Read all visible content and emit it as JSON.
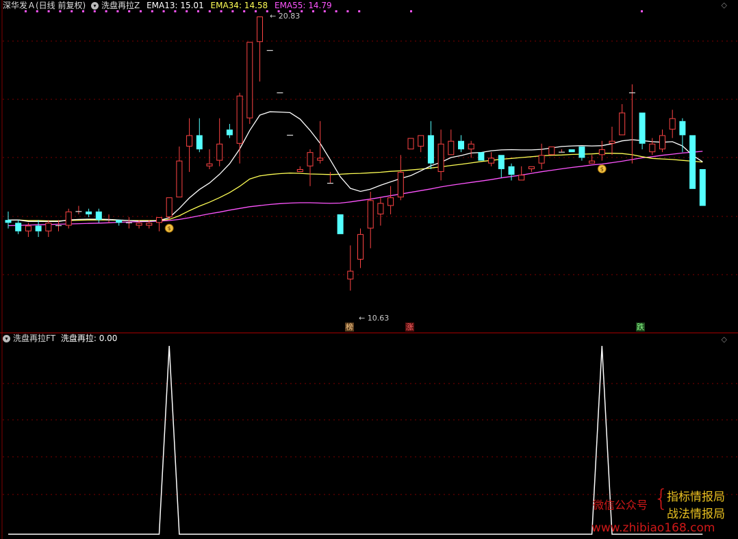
{
  "main_header": {
    "stock": "深华发Ａ(日线 前复权)",
    "indicator": "洗盘再拉Z",
    "ema13_label": "EMA13: 15.01",
    "ema34_label": "EMA34: 14.58",
    "ema55_label": "EMA55: 14.79"
  },
  "sub_header": {
    "indicator": "洗盘再拉FT",
    "value_label": "洗盘再拉: 0.00"
  },
  "price_labels": {
    "high": "20.83",
    "low": "10.63"
  },
  "event_tags": {
    "bang": "榜",
    "zhang": "涨",
    "die": "跌"
  },
  "window_icon": "◇",
  "watermark": {
    "wechat": "微信公众号",
    "line1": "指标情报局",
    "line2": "战法情报局",
    "url": "www.zhibiao168.com"
  },
  "colors": {
    "up": "#ff4444",
    "down": "#54ffff",
    "ema13": "#ffffff",
    "ema34": "#ffff55",
    "ema55": "#ff55ff",
    "grid": "#800000"
  },
  "chart_data": [
    {
      "type": "candlestick",
      "title": "洗盘再拉Z",
      "price_min_shown": 10.63,
      "price_max_shown": 20.83,
      "candles": [
        [
          13.6,
          13.5,
          13.9,
          13.3
        ],
        [
          13.5,
          13.2,
          13.6,
          13.1
        ],
        [
          13.2,
          13.4,
          13.5,
          13.0
        ],
        [
          13.4,
          13.2,
          13.6,
          13.0
        ],
        [
          13.2,
          13.5,
          13.6,
          13.0
        ],
        [
          13.4,
          13.4,
          13.6,
          13.2
        ],
        [
          13.4,
          13.9,
          14.0,
          13.3
        ],
        [
          13.9,
          13.9,
          14.1,
          13.8
        ],
        [
          13.9,
          13.8,
          14.0,
          13.7
        ],
        [
          13.9,
          13.6,
          14.0,
          13.5
        ],
        [
          13.6,
          13.6,
          13.8,
          13.5
        ],
        [
          13.6,
          13.5,
          13.6,
          13.4
        ],
        [
          13.5,
          13.5,
          13.7,
          13.3
        ],
        [
          13.4,
          13.5,
          13.6,
          13.3
        ],
        [
          13.4,
          13.5,
          13.6,
          13.3
        ],
        [
          13.5,
          13.7,
          13.7,
          13.2
        ],
        [
          13.7,
          14.4,
          14.4,
          13.6
        ],
        [
          14.4,
          15.7,
          16.2,
          14.4
        ],
        [
          16.2,
          16.6,
          17.2,
          15.3
        ],
        [
          16.6,
          16.1,
          17.2,
          16.0
        ],
        [
          15.5,
          15.6,
          16.1,
          15.4
        ],
        [
          15.7,
          16.3,
          17.2,
          15.5
        ],
        [
          16.8,
          16.6,
          17.0,
          16.5
        ],
        [
          16.3,
          18.0,
          18.1,
          15.6
        ],
        [
          17.2,
          19.9,
          19.9,
          17.0
        ],
        [
          19.9,
          20.8,
          20.8,
          18.5
        ],
        [
          19.6,
          19.6,
          19.6,
          19.6
        ],
        [
          18.1,
          18.1,
          18.1,
          18.1
        ],
        [
          16.6,
          16.6,
          16.6,
          16.6
        ],
        [
          15.3,
          15.4,
          15.5,
          15.3
        ],
        [
          15.5,
          16.0,
          16.1,
          14.8
        ],
        [
          15.7,
          15.8,
          17.1,
          15.6
        ],
        [
          14.9,
          14.9,
          15.3,
          14.9
        ],
        [
          13.8,
          13.1,
          13.8,
          13.1
        ],
        [
          11.5,
          11.8,
          12.7,
          11.1
        ],
        [
          12.2,
          13.1,
          13.3,
          11.9
        ],
        [
          13.3,
          14.3,
          14.6,
          12.6
        ],
        [
          13.8,
          14.2,
          14.4,
          13.4
        ],
        [
          14.1,
          14.4,
          14.8,
          13.8
        ],
        [
          14.4,
          15.3,
          15.9,
          14.3
        ],
        [
          16.1,
          16.5,
          16.5,
          16.3
        ],
        [
          16.2,
          16.6,
          16.6,
          16.0
        ],
        [
          16.6,
          15.6,
          17.1,
          15.4
        ],
        [
          15.3,
          16.3,
          16.8,
          15.0
        ],
        [
          15.9,
          16.4,
          16.8,
          15.9
        ],
        [
          16.4,
          16.1,
          16.6,
          16.0
        ],
        [
          16.1,
          16.3,
          16.4,
          15.8
        ],
        [
          16.0,
          15.7,
          16.0,
          15.7
        ],
        [
          15.6,
          15.8,
          16.0,
          15.5
        ],
        [
          15.9,
          15.4,
          15.9,
          15.1
        ],
        [
          15.5,
          15.2,
          15.6,
          15.0
        ],
        [
          15.0,
          15.2,
          15.5,
          15.0
        ],
        [
          15.4,
          15.5,
          15.5,
          15.3
        ],
        [
          15.6,
          15.9,
          16.3,
          15.4
        ],
        [
          15.9,
          16.2,
          16.2,
          16.0
        ],
        [
          16.0,
          16.0,
          16.1,
          16.0
        ],
        [
          16.1,
          16.0,
          16.1,
          16.0
        ],
        [
          16.2,
          15.8,
          16.2,
          15.7
        ],
        [
          15.6,
          15.7,
          15.9,
          15.6
        ],
        [
          15.9,
          16.1,
          16.4,
          15.7
        ],
        [
          16.3,
          16.4,
          16.9,
          15.9
        ],
        [
          16.6,
          17.4,
          17.7,
          16.6
        ],
        [
          18.1,
          18.1,
          18.4,
          15.6
        ],
        [
          17.4,
          16.3,
          17.4,
          16.1
        ],
        [
          16.0,
          16.3,
          16.5,
          15.9
        ],
        [
          16.1,
          16.6,
          16.8,
          16.0
        ],
        [
          16.8,
          17.2,
          17.5,
          16.5
        ],
        [
          17.1,
          16.6,
          17.2,
          16.0
        ],
        [
          16.6,
          14.7,
          16.6,
          14.7
        ],
        [
          15.4,
          14.1,
          15.4,
          14.1
        ]
      ],
      "ema13": [
        13.6,
        13.6,
        13.55,
        13.55,
        13.55,
        13.55,
        13.6,
        13.62,
        13.63,
        13.63,
        13.62,
        13.6,
        13.58,
        13.56,
        13.56,
        13.58,
        13.68,
        14.01,
        14.38,
        14.68,
        14.91,
        15.22,
        15.59,
        16.11,
        16.77,
        17.31,
        17.43,
        17.42,
        17.4,
        17.17,
        16.77,
        16.31,
        15.73,
        15.13,
        14.72,
        14.61,
        14.69,
        14.83,
        14.95,
        15.07,
        15.17,
        15.34,
        15.52,
        15.64,
        15.81,
        15.88,
        15.97,
        15.99,
        16.05,
        16.08,
        16.09,
        16.08,
        16.08,
        16.1,
        16.15,
        16.2,
        16.22,
        16.23,
        16.22,
        16.23,
        16.3,
        16.4,
        16.44,
        16.41,
        16.37,
        16.35,
        16.37,
        16.22,
        15.89,
        15.66
      ],
      "ema34": [
        13.6,
        13.6,
        13.58,
        13.58,
        13.57,
        13.57,
        13.58,
        13.59,
        13.6,
        13.6,
        13.6,
        13.59,
        13.58,
        13.58,
        13.58,
        13.58,
        13.62,
        13.75,
        13.93,
        14.09,
        14.23,
        14.39,
        14.57,
        14.79,
        15.05,
        15.16,
        15.21,
        15.24,
        15.26,
        15.25,
        15.23,
        15.22,
        15.21,
        15.22,
        15.24,
        15.25,
        15.27,
        15.29,
        15.32,
        15.34,
        15.37,
        15.4,
        15.44,
        15.48,
        15.53,
        15.57,
        15.62,
        15.67,
        15.71,
        15.75,
        15.78,
        15.81,
        15.84,
        15.87,
        15.89,
        15.9,
        15.92,
        15.93,
        15.94,
        15.96,
        15.96,
        15.95,
        15.91,
        15.84,
        15.78,
        15.76,
        15.74,
        15.71,
        15.68,
        15.65
      ],
      "ema55": [
        13.4,
        13.41,
        13.42,
        13.43,
        13.44,
        13.45,
        13.46,
        13.47,
        13.48,
        13.49,
        13.5,
        13.52,
        13.53,
        13.54,
        13.55,
        13.56,
        13.58,
        13.62,
        13.68,
        13.75,
        13.82,
        13.88,
        13.95,
        14.01,
        14.07,
        14.11,
        14.15,
        14.18,
        14.2,
        14.21,
        14.21,
        14.2,
        14.19,
        14.2,
        14.24,
        14.29,
        14.34,
        14.4,
        14.46,
        14.52,
        14.58,
        14.64,
        14.7,
        14.77,
        14.83,
        14.88,
        14.93,
        14.98,
        15.03,
        15.09,
        15.14,
        15.19,
        15.25,
        15.31,
        15.36,
        15.41,
        15.46,
        15.5,
        15.55,
        15.58,
        15.63,
        15.68,
        15.74,
        15.8,
        15.84,
        15.89,
        15.93,
        15.97,
        16.0,
        16.03
      ],
      "xiban_markers": [
        16,
        59
      ]
    },
    {
      "type": "line",
      "title": "洗盘再拉FT",
      "series": [
        {
          "name": "洗盘再拉",
          "values": [
            0,
            0,
            0,
            0,
            0,
            0,
            0,
            0,
            0,
            0,
            0,
            0,
            0,
            0,
            0,
            0,
            1,
            0,
            0,
            0,
            0,
            0,
            0,
            0,
            0,
            0,
            0,
            0,
            0,
            0,
            0,
            0,
            0,
            0,
            0,
            0,
            0,
            0,
            0,
            0,
            0,
            0,
            0,
            0,
            0,
            0,
            0,
            0,
            0,
            0,
            0,
            0,
            0,
            0,
            0,
            0,
            0,
            0,
            0,
            1,
            0,
            0,
            0,
            0,
            0,
            0,
            0,
            0,
            0,
            0
          ]
        }
      ]
    }
  ]
}
